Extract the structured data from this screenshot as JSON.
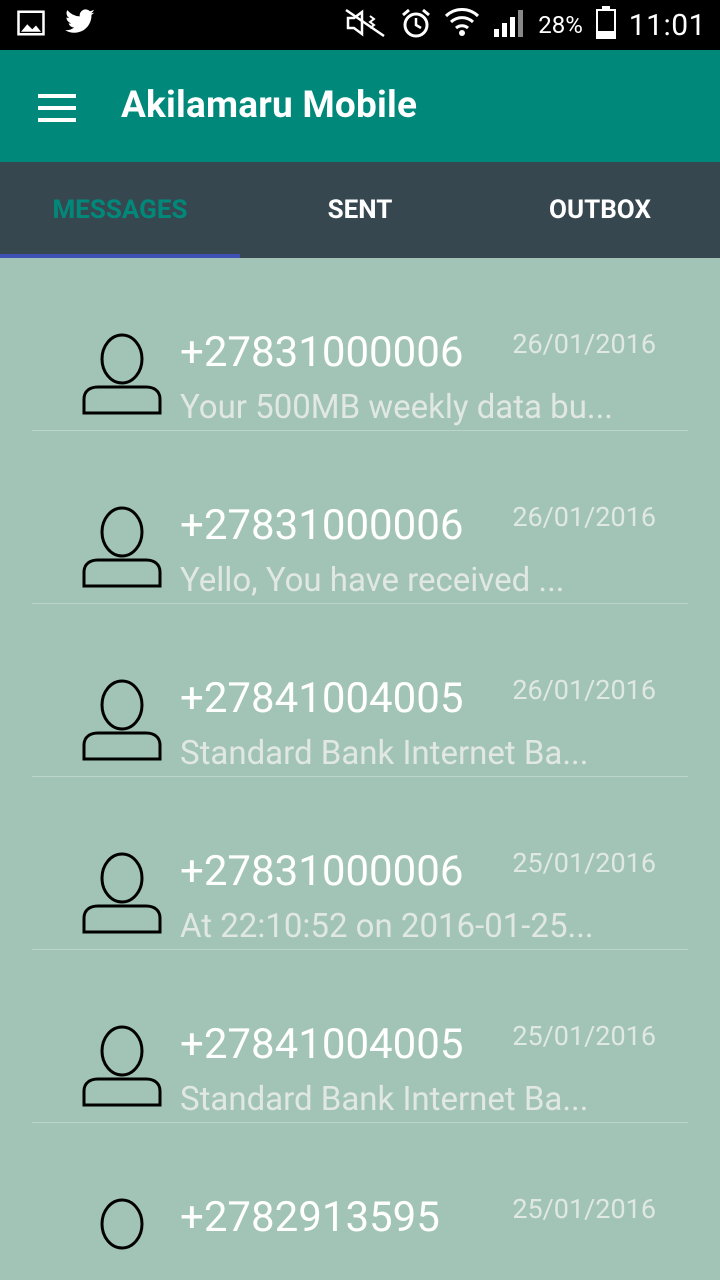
{
  "status_bar": {
    "battery_percent": "28%",
    "time": "11:01",
    "icons": [
      "image-icon",
      "twitter-icon",
      "mute-icon",
      "alarm-icon",
      "wifi-icon",
      "signal-icon",
      "battery-icon"
    ]
  },
  "app_bar": {
    "title": "Akilamaru Mobile",
    "menu_icon": "hamburger-menu-icon"
  },
  "tabs": [
    {
      "label": "MESSAGES",
      "active": true
    },
    {
      "label": "SENT",
      "active": false
    },
    {
      "label": "OUTBOX",
      "active": false
    }
  ],
  "messages": [
    {
      "number": "+27831000006",
      "date": "26/01/2016",
      "snippet": "Your 500MB weekly data bu..."
    },
    {
      "number": "+27831000006",
      "date": "26/01/2016",
      "snippet": "Yello, You have received ..."
    },
    {
      "number": "+27841004005",
      "date": "26/01/2016",
      "snippet": "Standard Bank Internet Ba..."
    },
    {
      "number": "+27831000006",
      "date": "25/01/2016",
      "snippet": "At 22:10:52 on 2016-01-25..."
    },
    {
      "number": "+27841004005",
      "date": "25/01/2016",
      "snippet": "Standard Bank Internet Ba..."
    },
    {
      "number": "+2782913595",
      "date": "25/01/2016",
      "snippet": ""
    }
  ]
}
